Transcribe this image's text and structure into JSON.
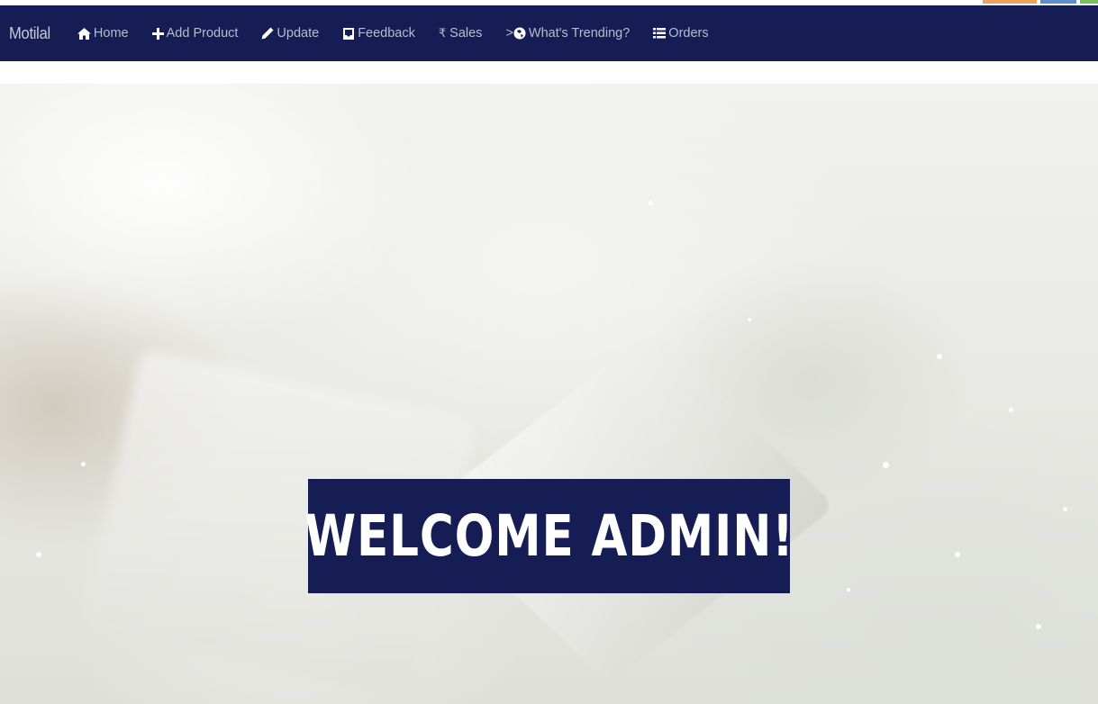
{
  "navbar": {
    "brand": "Motilal",
    "items": [
      {
        "label": "Home",
        "icon": "home-icon"
      },
      {
        "label": "Add Product",
        "icon": "plus-icon"
      },
      {
        "label": "Update",
        "icon": "pencil-icon"
      },
      {
        "label": "Feedback",
        "icon": "inbox-icon"
      },
      {
        "label": "Sales",
        "icon": "rupee-icon",
        "icon_glyph": "₹"
      },
      {
        "label": "What's Trending?",
        "icon": "globe-icon",
        "icon_prefix": ">"
      },
      {
        "label": "Orders",
        "icon": "list-icon"
      }
    ]
  },
  "hero": {
    "welcome_text": "WELCOME ADMIN!"
  },
  "colors": {
    "navbar_bg": "#151d54",
    "nav_text": "#b8bccb",
    "welcome_bg": "#151d54",
    "welcome_text": "#ffffff"
  }
}
